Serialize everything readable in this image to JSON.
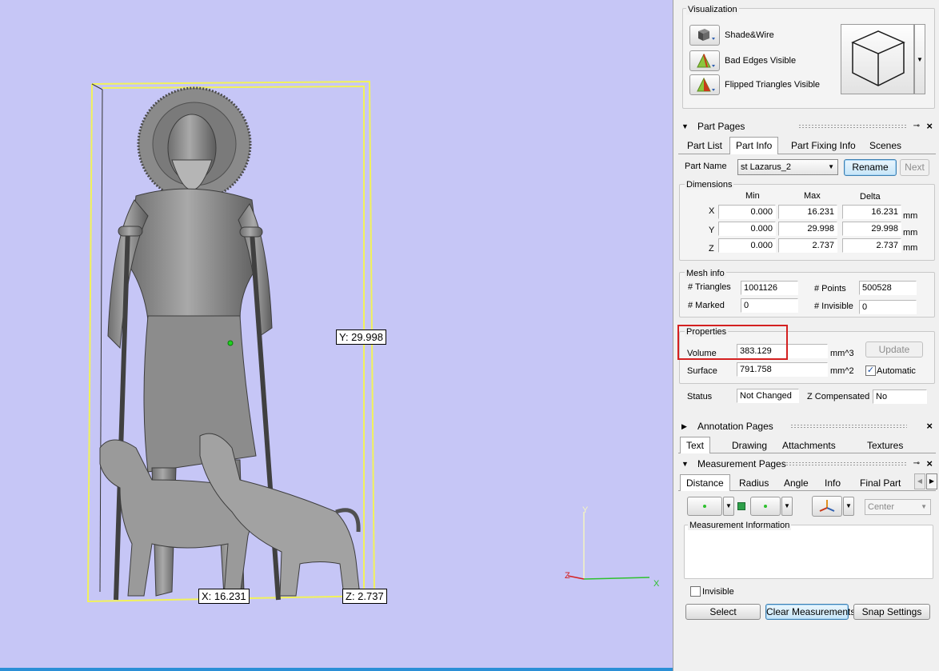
{
  "viewport": {
    "labels": {
      "y": "Y: 29.998",
      "x": "X: 16.231",
      "z": "Z: 2.737"
    },
    "axes": {
      "y": "Y",
      "z": "Z",
      "x": "X"
    }
  },
  "visualization": {
    "title": "Visualization",
    "items": [
      {
        "label": "Shade&Wire",
        "icon": "cube-icon"
      },
      {
        "label": "Bad Edges Visible",
        "icon": "triangle-icon"
      },
      {
        "label": "Flipped Triangles Visible",
        "icon": "triangle-icon"
      }
    ]
  },
  "part_pages": {
    "title": "Part Pages",
    "tabs": [
      "Part List",
      "Part Info",
      "Part Fixing Info",
      "Scenes"
    ],
    "active_tab": "Part Info",
    "part_name_label": "Part Name",
    "part_name_value": "st Lazarus_2",
    "rename_label": "Rename",
    "next_label": "Next",
    "dimensions": {
      "title": "Dimensions",
      "headers": [
        "Min",
        "Max",
        "Delta"
      ],
      "rows": [
        {
          "axis": "X",
          "min": "0.000",
          "max": "16.231",
          "delta": "16.231",
          "unit": "mm"
        },
        {
          "axis": "Y",
          "min": "0.000",
          "max": "29.998",
          "delta": "29.998",
          "unit": "mm"
        },
        {
          "axis": "Z",
          "min": "0.000",
          "max": "2.737",
          "delta": "2.737",
          "unit": "mm"
        }
      ]
    },
    "mesh_info": {
      "title": "Mesh info",
      "triangles_label": "# Triangles",
      "triangles_value": "1001126",
      "points_label": "# Points",
      "points_value": "500528",
      "marked_label": "# Marked",
      "marked_value": "0",
      "invisible_label": "# Invisible",
      "invisible_value": "0"
    },
    "properties": {
      "title": "Properties",
      "volume_label": "Volume",
      "volume_value": "383.129",
      "volume_unit": "mm^3",
      "update_label": "Update",
      "surface_label": "Surface",
      "surface_value": "791.758",
      "surface_unit": "mm^2",
      "automatic_label": "Automatic",
      "automatic_checked": true
    },
    "status": {
      "status_label": "Status",
      "status_value": "Not Changed",
      "z_comp_label": "Z Compensated",
      "z_comp_value": "No"
    }
  },
  "annotation_pages": {
    "title": "Annotation Pages",
    "tabs": [
      "Text",
      "Drawing",
      "Attachments",
      "Textures"
    ],
    "active_tab": "Text"
  },
  "measurement_pages": {
    "title": "Measurement Pages",
    "tabs": [
      "Distance",
      "Radius",
      "Angle",
      "Info",
      "Final Part"
    ],
    "active_tab": "Distance",
    "center_select": "Center",
    "info_title": "Measurement Information",
    "invisible_label": "Invisible",
    "select_label": "Select",
    "clear_label": "Clear Measurements",
    "snap_label": "Snap Settings"
  },
  "colors": {
    "viewport_bg": "#c6c6f6",
    "bbox": "#f2f25a",
    "highlight": "#d42020"
  }
}
